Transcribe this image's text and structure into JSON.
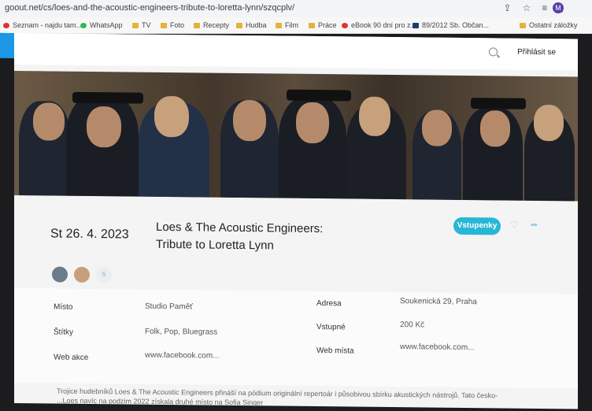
{
  "browser": {
    "url": "goout.net/cs/loes-and-the-acoustic-engineers-tribute-to-loretta-lynn/szqcplv/",
    "avatar_letter": "M",
    "bookmarks": [
      "Seznam - najdu tam...",
      "WhatsApp",
      "TV",
      "Foto",
      "Recepty",
      "Hudba",
      "Film",
      "Práce",
      "eBook 90 dní pro z...",
      "89/2012 Sb. Občan...",
      "Ostatní záložky"
    ]
  },
  "header": {
    "login_label": "Přihlásit se"
  },
  "event": {
    "date": "St 26. 4. 2023",
    "title_line1": "Loes & The Acoustic Engineers:",
    "title_line2": "Tribute to Loretta Lynn",
    "tickets_label": "Vstupenky",
    "attendees_extra": "5"
  },
  "details": {
    "misto_label": "Místo",
    "misto_value": "Studio Paměť",
    "stitky_label": "Štítky",
    "stitky_value": "Folk, Pop, Bluegrass",
    "web_akce_label": "Web akce",
    "web_akce_value": "www.facebook.com...",
    "adresa_label": "Adresa",
    "adresa_value": "Soukenická 29, Praha",
    "vstupne_label": "Vstupné",
    "vstupne_value": "200 Kč",
    "web_mista_label": "Web místa",
    "web_mista_value": "www.facebook.com..."
  },
  "description": {
    "line1": "Trojice hudebníků Loes & The Acoustic Engineers přináší na pódium originální repertoár i působivou sbírku akustických nástrojů. Tato česko-",
    "line2": "...Loes navíc na podzim 2022 získala druhé místo na Sofia Singer"
  },
  "icons": {
    "search": "search-icon",
    "heart": "heart-icon",
    "share": "share-icon"
  },
  "colors": {
    "accent": "#28b6d6",
    "brand_strip": "#1b97e6"
  }
}
